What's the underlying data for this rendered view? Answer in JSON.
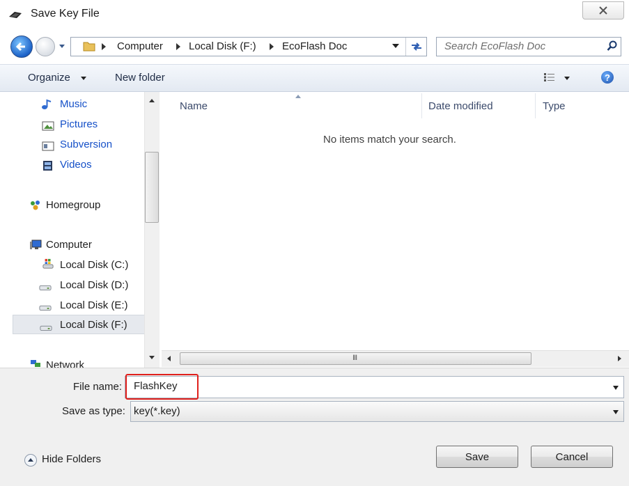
{
  "window": {
    "title": "Save Key File",
    "close_glyph": "x"
  },
  "nav": {
    "breadcrumbs": [
      "Computer",
      "Local Disk (F:)",
      "EcoFlash Doc"
    ],
    "search_placeholder": "Search EcoFlash Doc"
  },
  "toolbar": {
    "organize": "Organize",
    "new_folder": "New folder",
    "help": "?"
  },
  "sidebar": {
    "items": [
      {
        "label": "Music",
        "icon": "music-note-icon",
        "kind": "library"
      },
      {
        "label": "Pictures",
        "icon": "pictures-icon",
        "kind": "library"
      },
      {
        "label": "Subversion",
        "icon": "subversion-icon",
        "kind": "library"
      },
      {
        "label": "Videos",
        "icon": "videos-icon",
        "kind": "library"
      },
      {
        "label": "Homegroup",
        "icon": "homegroup-icon",
        "kind": "group"
      },
      {
        "label": "Computer",
        "icon": "computer-icon",
        "kind": "group"
      },
      {
        "label": "Local Disk (C:)",
        "icon": "system-drive-icon",
        "kind": "drive"
      },
      {
        "label": "Local Disk (D:)",
        "icon": "drive-icon",
        "kind": "drive"
      },
      {
        "label": "Local Disk (E:)",
        "icon": "drive-icon",
        "kind": "drive"
      },
      {
        "label": "Local Disk (F:)",
        "icon": "drive-icon",
        "kind": "drive",
        "selected": true
      },
      {
        "label": "Network",
        "icon": "network-icon",
        "kind": "group"
      }
    ]
  },
  "content": {
    "columns": [
      "Name",
      "Date modified",
      "Type"
    ],
    "empty_message": "No items match your search.",
    "hscroll_grip": "III"
  },
  "bottom": {
    "file_name_label": "File name:",
    "file_name_value": "FlashKey",
    "save_type_label": "Save as type:",
    "save_type_value": "key(*.key)",
    "hide_folders": "Hide Folders",
    "save_button": "Save",
    "cancel_button": "Cancel"
  },
  "colors": {
    "highlight": "#e0201c",
    "link_blue": "#1550c8"
  }
}
